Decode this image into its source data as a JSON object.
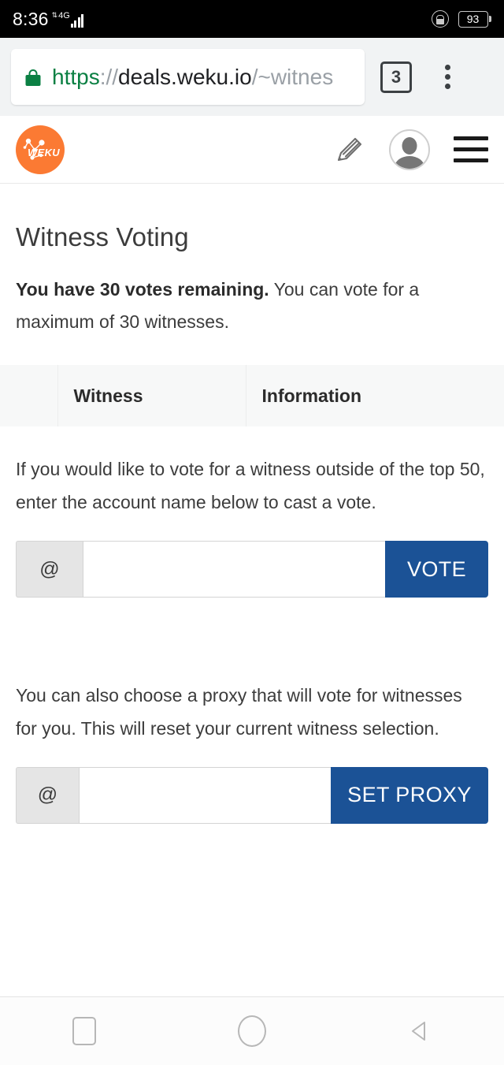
{
  "status_bar": {
    "clock": "8:36",
    "network_type": "4G",
    "signal_arrows": "⇅",
    "battery_percent": "93",
    "rotation_lock_icon": "rotation-lock-icon",
    "signal_icon": "signal-bars-icon"
  },
  "browser": {
    "lock_icon": "https-lock-icon",
    "url": {
      "scheme": "https",
      "separator": "://",
      "host": "deals.weku.io",
      "path": "/~witnes"
    },
    "url_full": "https://deals.weku.io/~witnes",
    "tab_count": "3",
    "overflow_menu_label": "More options"
  },
  "site_header": {
    "logo_text": "WEKU",
    "logo_color": "#fb7a33",
    "pencil_icon": "pencil-write-icon",
    "avatar_icon": "user-avatar-icon",
    "menu_icon": "hamburger-menu-icon"
  },
  "page": {
    "title": "Witness Voting",
    "intro_bold": "You have 30 votes remaining.",
    "intro_rest": " You can vote for a maximum of 30 witnesses.",
    "table": {
      "columns": [
        "",
        "Witness",
        "Information"
      ]
    },
    "vote_section": {
      "description": "If you would like to vote for a witness outside of the top 50, enter the account name below to cast a vote.",
      "addon": "@",
      "input_value": "",
      "input_placeholder": "",
      "button_label": "VOTE"
    },
    "proxy_section": {
      "description": "You can also choose a proxy that will vote for witnesses for you. This will reset your current witness selection.",
      "addon": "@",
      "input_value": "",
      "input_placeholder": "",
      "button_label": "SET PROXY"
    },
    "accent_color": "#1b5296"
  },
  "nav_bar": {
    "recents_icon": "square-recents-icon",
    "home_icon": "circle-home-icon",
    "back_icon": "triangle-back-icon"
  }
}
